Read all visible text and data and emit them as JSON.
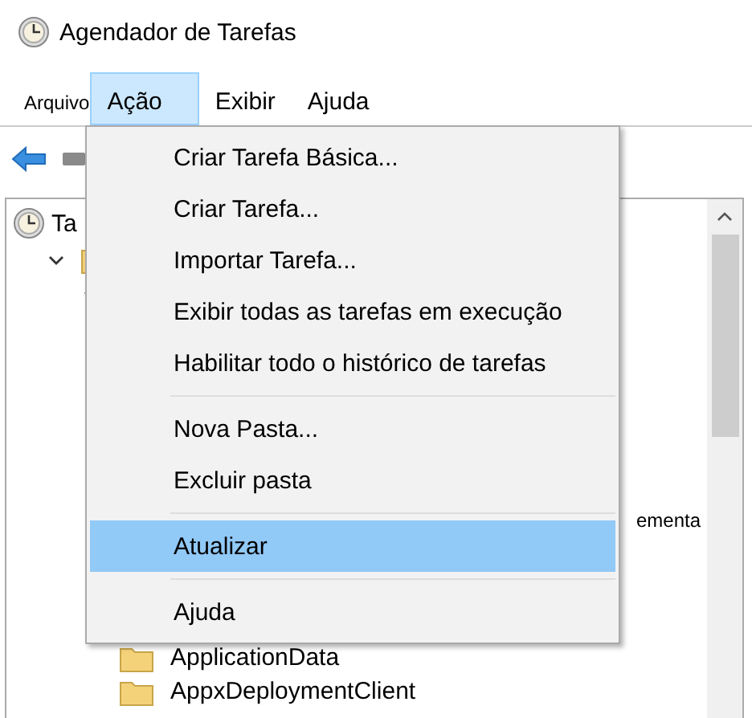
{
  "window": {
    "title": "Agendador de Tarefas"
  },
  "menubar": [
    {
      "label": "Arquivo",
      "selected": false
    },
    {
      "label": "Ação",
      "selected": true
    },
    {
      "label": "Exibir",
      "selected": false
    },
    {
      "label": "Ajuda",
      "selected": false
    }
  ],
  "tree": [
    {
      "label": "Ta",
      "kind": "clock",
      "children": [
        {
          "kind": "folder",
          "expanded": true,
          "children": [
            {
              "kind": "blank",
              "expanded": true,
              "children": [
                {
                  "kind": "tail",
                  "label": "ementa"
                },
                {
                  "kind": "folder",
                  "label": "ApplicationData"
                },
                {
                  "kind": "folder",
                  "label": "AppxDeploymentClient"
                }
              ]
            }
          ]
        }
      ]
    }
  ],
  "menu": [
    {
      "kind": "item",
      "label": "Criar Tarefa Básica...",
      "selected": false
    },
    {
      "kind": "item",
      "label": "Criar Tarefa...",
      "selected": false
    },
    {
      "kind": "item",
      "label": "Importar Tarefa...",
      "selected": false
    },
    {
      "kind": "item",
      "label": "Exibir todas as tarefas em execução",
      "selected": false
    },
    {
      "kind": "item",
      "label": "Habilitar todo o histórico de tarefas",
      "selected": false
    },
    {
      "kind": "separator"
    },
    {
      "kind": "item",
      "label": "Nova Pasta...",
      "selected": false
    },
    {
      "kind": "item",
      "label": "Excluir pasta",
      "selected": false
    },
    {
      "kind": "separator"
    },
    {
      "kind": "item",
      "label": "Atualizar",
      "selected": true
    },
    {
      "kind": "separator"
    },
    {
      "kind": "item",
      "label": "Ajuda",
      "selected": false
    }
  ]
}
